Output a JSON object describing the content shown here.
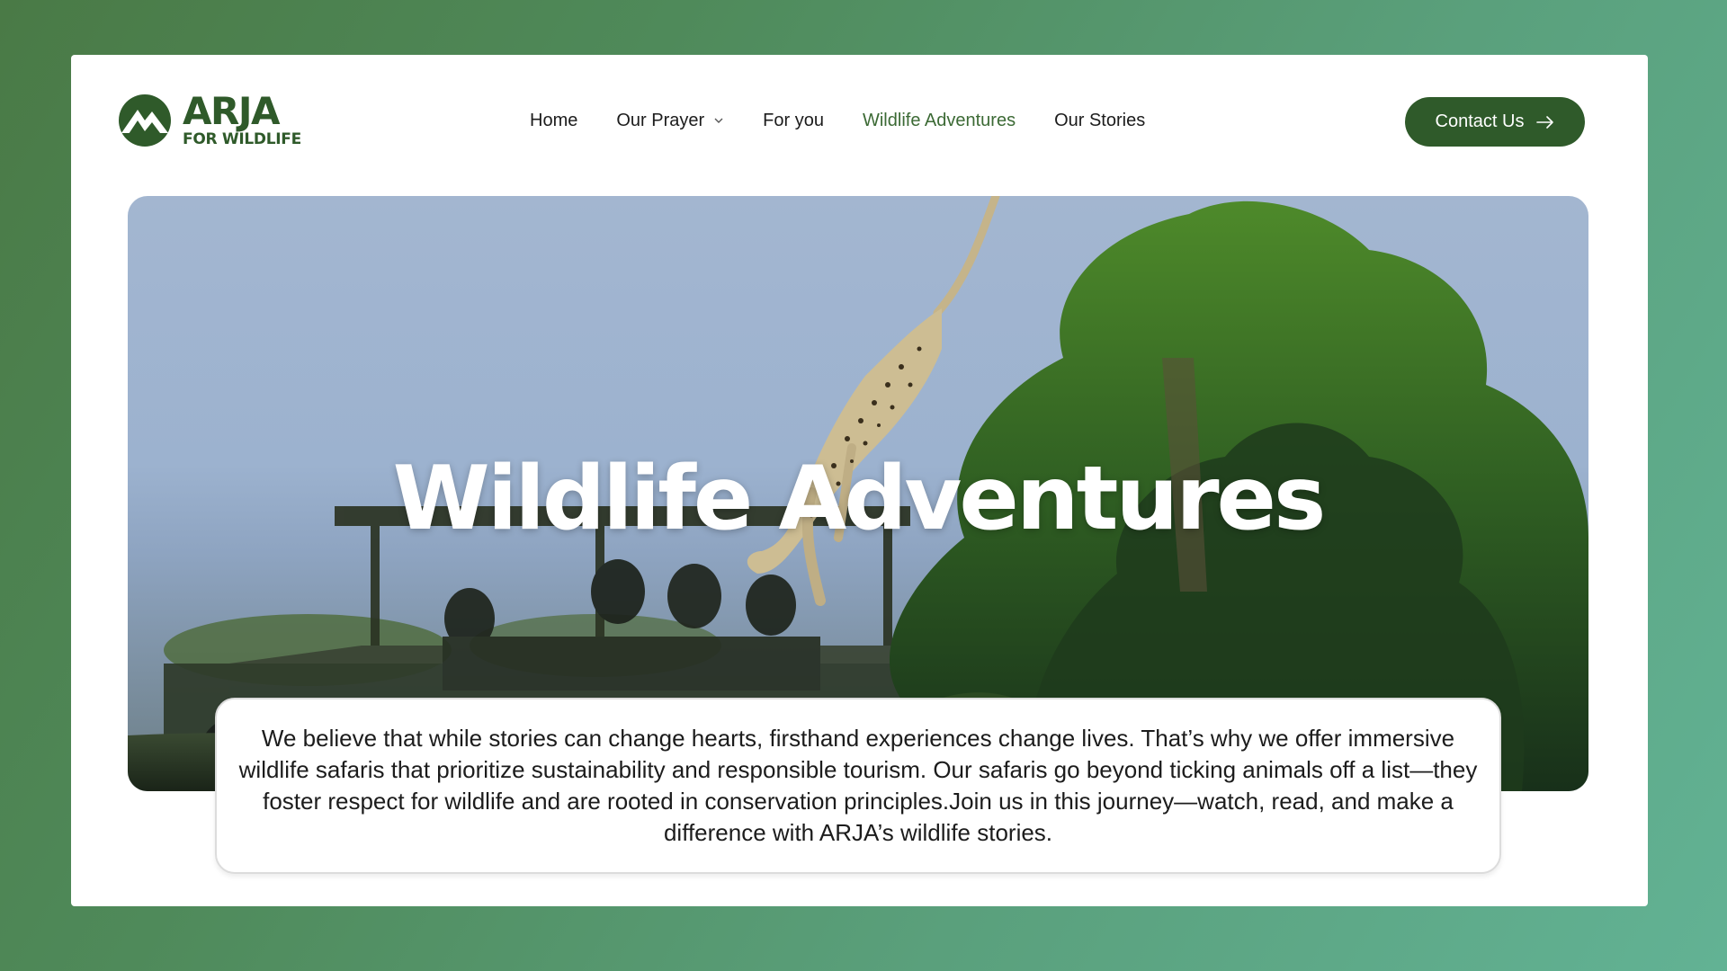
{
  "brand": {
    "name": "ARJA",
    "tagline": "FOR WILDLIFE",
    "logo_icon": "mountain-circle-icon",
    "color": "#2f5a2a"
  },
  "nav": {
    "items": [
      {
        "label": "Home",
        "active": false
      },
      {
        "label": "Our Prayer",
        "active": false,
        "dropdown": true
      },
      {
        "label": "For you",
        "active": false
      },
      {
        "label": "Wildlife Adventures",
        "active": true
      },
      {
        "label": "Our Stories",
        "active": false
      }
    ],
    "active_color": "#3c6a35"
  },
  "header": {
    "contact_label": "Contact Us",
    "contact_icon": "arrow-right-icon"
  },
  "hero": {
    "title": "Wildlife Adventures",
    "image_subject": "cheetah-leaping-from-tree-near-safari-vehicle"
  },
  "description": {
    "text": "We believe that while stories can change hearts, firsthand experiences change lives. That’s why we offer immersive wildlife safaris that prioritize sustainability and responsible tourism. Our safaris go beyond ticking animals off a list—they foster respect for wildlife and are rooted in conservation principles.Join us in this journey—watch, read, and make a difference with ARJA’s wildlife stories."
  }
}
